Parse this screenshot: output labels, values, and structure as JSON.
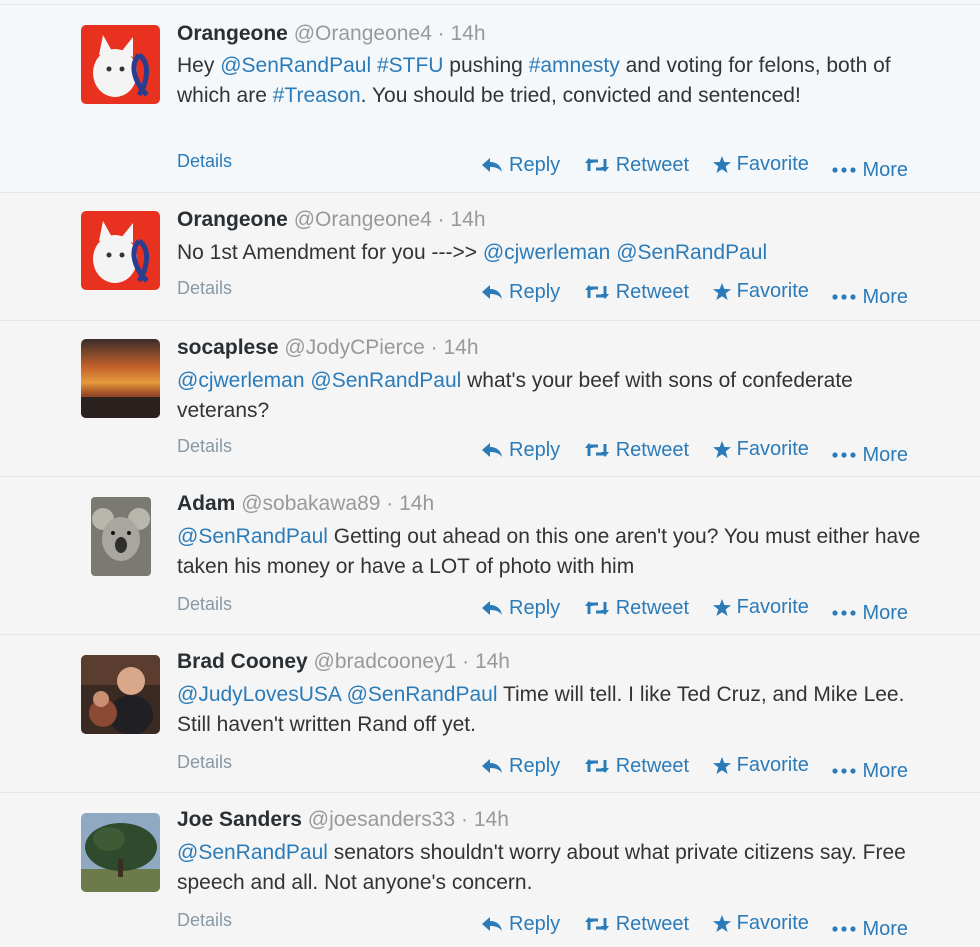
{
  "actions": {
    "details": "Details",
    "reply": "Reply",
    "retweet": "Retweet",
    "favorite": "Favorite",
    "more": "More"
  },
  "colors": {
    "link": "#2b7bb9",
    "muted": "#999999",
    "text": "#333333"
  },
  "tweets": [
    {
      "name": "Orangeone",
      "handle": "@Orangeone4",
      "time": "· 14h",
      "segments": [
        {
          "t": "Hey ",
          "link": false
        },
        {
          "t": "@SenRandPaul",
          "link": true
        },
        {
          "t": " ",
          "link": false
        },
        {
          "t": "#STFU",
          "link": true
        },
        {
          "t": " pushing ",
          "link": false
        },
        {
          "t": "#amnesty",
          "link": true
        },
        {
          "t": " and voting for felons, both of which are ",
          "link": false
        },
        {
          "t": "#Treason",
          "link": true
        },
        {
          "t": ". You should be tried, convicted and sentenced!",
          "link": false
        }
      ]
    },
    {
      "name": "Orangeone",
      "handle": "@Orangeone4",
      "time": "· 14h",
      "segments": [
        {
          "t": "No 1st Amendment for you --->> ",
          "link": false
        },
        {
          "t": "@cjwerleman",
          "link": true
        },
        {
          "t": " ",
          "link": false
        },
        {
          "t": "@SenRandPaul",
          "link": true
        }
      ]
    },
    {
      "name": "socaplese",
      "handle": "@JodyCPierce",
      "time": "· 14h",
      "segments": [
        {
          "t": "@cjwerleman",
          "link": true
        },
        {
          "t": " ",
          "link": false
        },
        {
          "t": "@SenRandPaul",
          "link": true
        },
        {
          "t": " what's your beef with sons of confederate veterans?",
          "link": false
        }
      ]
    },
    {
      "name": "Adam",
      "handle": "@sobakawa89",
      "time": "· 14h",
      "segments": [
        {
          "t": "@SenRandPaul",
          "link": true
        },
        {
          "t": " Getting out ahead on this one aren't you? You must either have taken his money or have a LOT of photo with him",
          "link": false
        }
      ]
    },
    {
      "name": "Brad Cooney",
      "handle": "@bradcooney1",
      "time": "· 14h",
      "segments": [
        {
          "t": "@JudyLovesUSA",
          "link": true
        },
        {
          "t": " ",
          "link": false
        },
        {
          "t": "@SenRandPaul",
          "link": true
        },
        {
          "t": " Time will tell. I like Ted Cruz, and Mike Lee. Still haven't written Rand off yet.",
          "link": false
        }
      ]
    },
    {
      "name": "Joe Sanders",
      "handle": "@joesanders33",
      "time": "· 14h",
      "segments": [
        {
          "t": "@SenRandPaul",
          "link": true
        },
        {
          "t": " senators shouldn't worry about what private citizens say. Free speech and all. Not anyone's concern.",
          "link": false
        }
      ]
    }
  ]
}
